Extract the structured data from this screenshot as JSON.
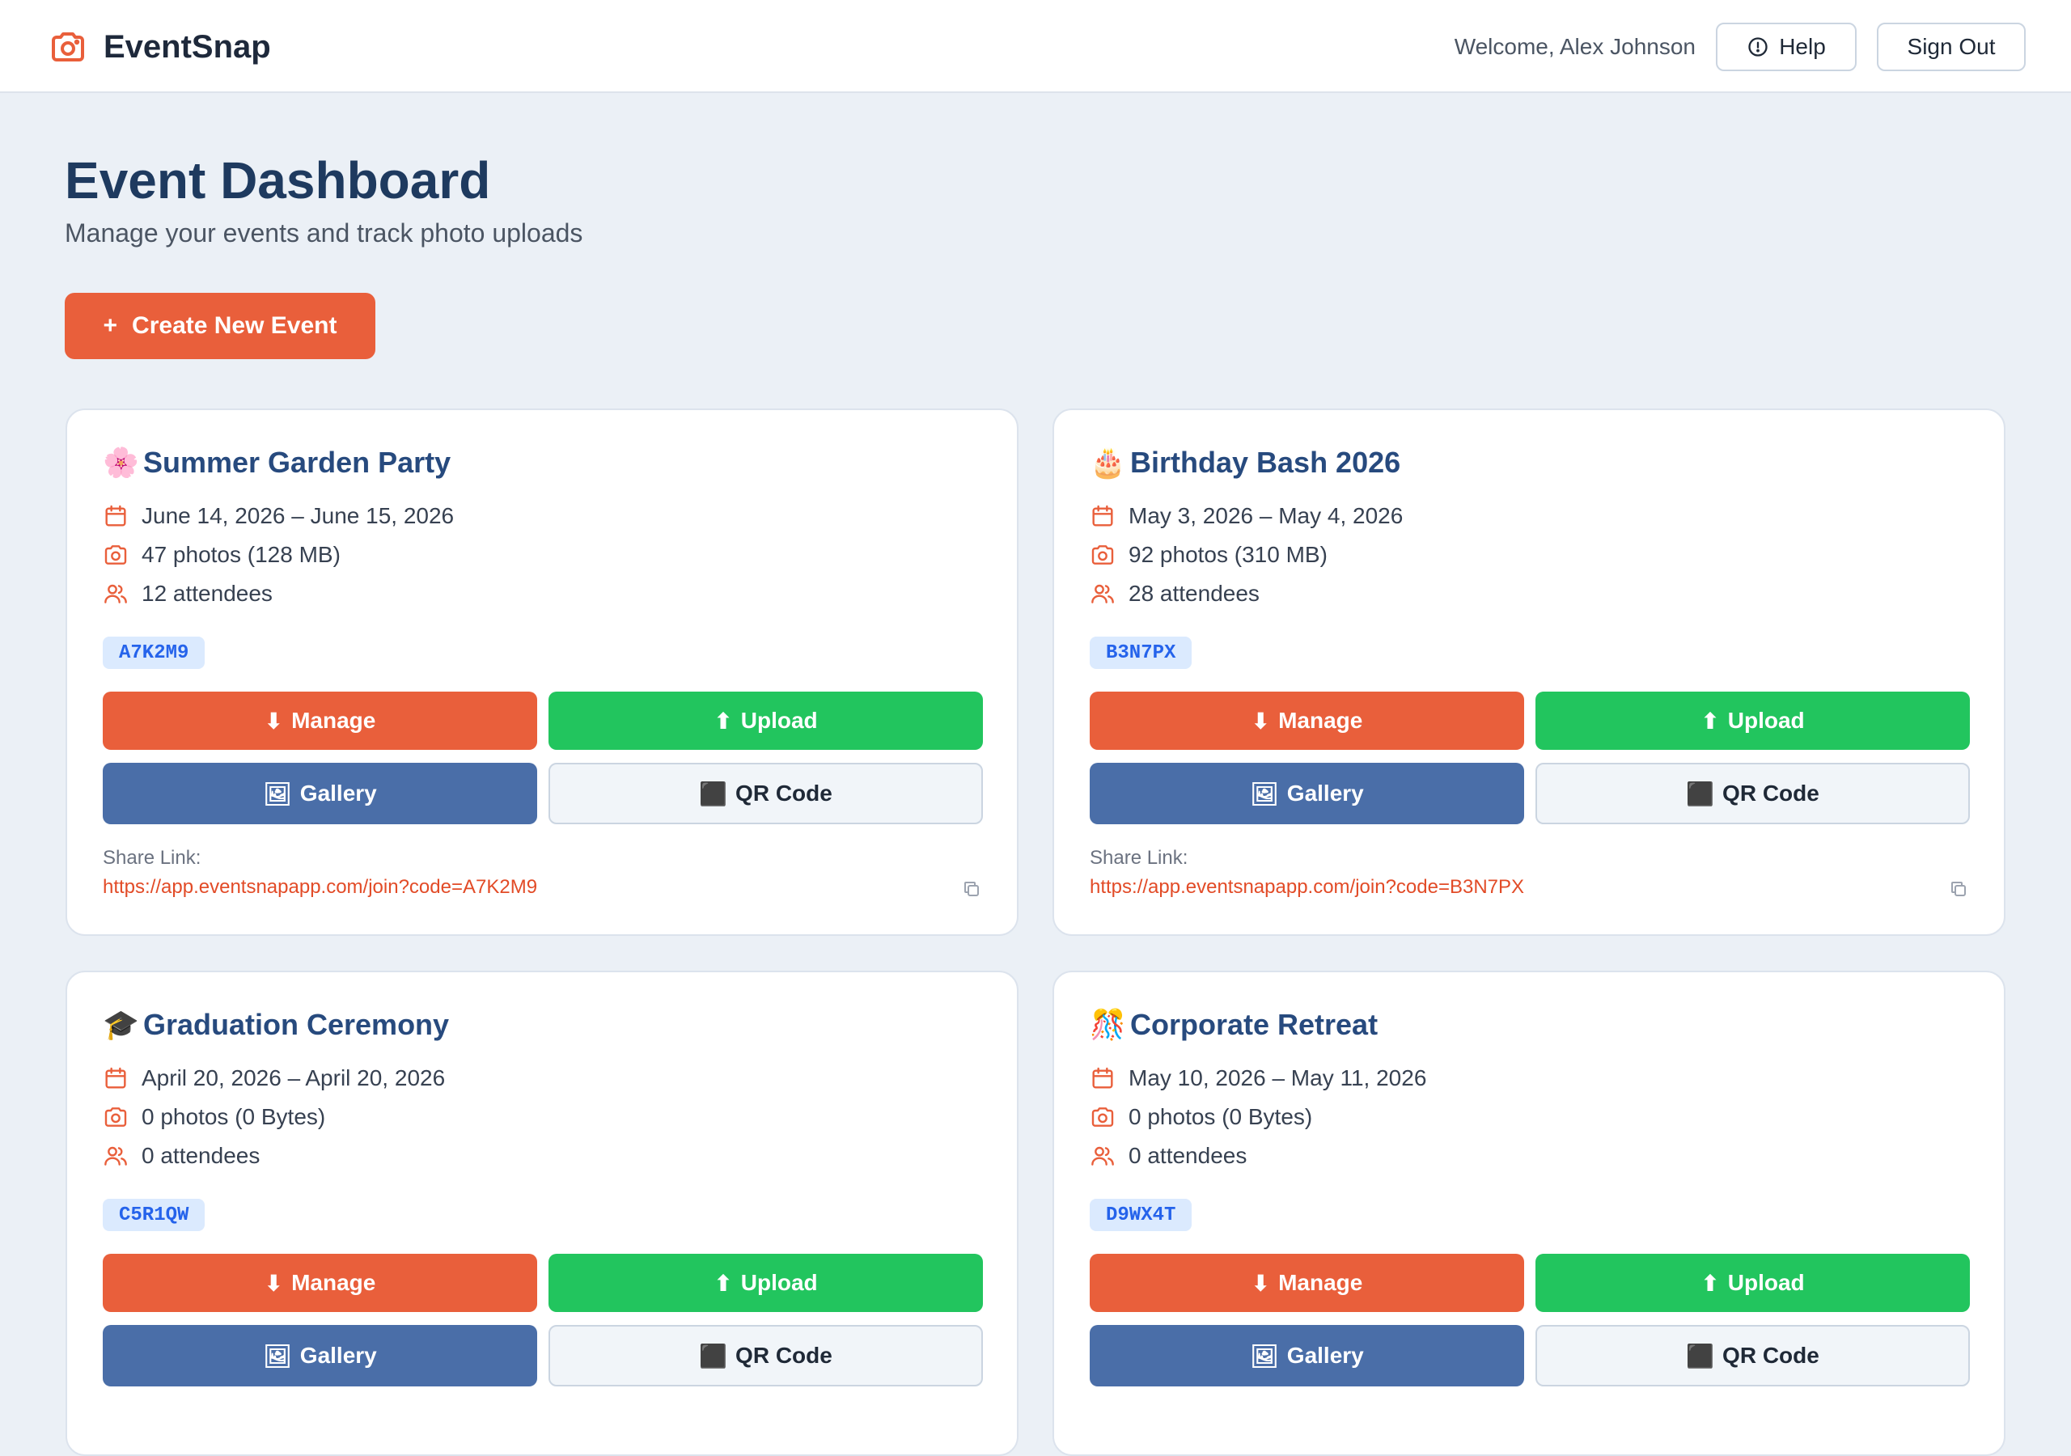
{
  "header": {
    "brand": "EventSnap",
    "welcome": "Welcome, Alex Johnson",
    "help_label": "Help",
    "signout_label": "Sign Out"
  },
  "page": {
    "title": "Event Dashboard",
    "subtitle": "Manage your events and track photo uploads",
    "create_label": "Create New Event"
  },
  "actions": {
    "manage": "Manage",
    "upload": "Upload",
    "gallery": "Gallery",
    "qr": "QR Code",
    "share_label": "Share Link:"
  },
  "icons": {
    "manage": "⬇",
    "upload": "⬆",
    "gallery": "🖼",
    "qr": "⬛",
    "create": "+"
  },
  "events": [
    {
      "emoji": "🌸",
      "name": "Summer Garden Party",
      "dates": "June 14, 2026 – June 15, 2026",
      "photos": "47 photos (128 MB)",
      "attendees": "12 attendees",
      "code": "A7K2M9",
      "share_url": "https://app.eventsnapapp.com/join?code=A7K2M9"
    },
    {
      "emoji": "🎂",
      "name": "Birthday Bash 2026",
      "dates": "May 3, 2026 – May 4, 2026",
      "photos": "92 photos (310 MB)",
      "attendees": "28 attendees",
      "code": "B3N7PX",
      "share_url": "https://app.eventsnapapp.com/join?code=B3N7PX"
    },
    {
      "emoji": "🎓",
      "name": "Graduation Ceremony",
      "dates": "April 20, 2026 – April 20, 2026",
      "photos": "0 photos (0 Bytes)",
      "attendees": "0 attendees",
      "code": "C5R1QW"
    },
    {
      "emoji": "🎊",
      "name": "Corporate Retreat",
      "dates": "May 10, 2026 – May 11, 2026",
      "photos": "0 photos (0 Bytes)",
      "attendees": "0 attendees",
      "code": "D9WX4T"
    }
  ],
  "colors": {
    "accent": "#e95f3b",
    "success": "#22c55e",
    "gallery": "#4a6ea8",
    "title": "#1e3a5f",
    "event_title": "#274a7e",
    "background": "#ebf0f6"
  }
}
